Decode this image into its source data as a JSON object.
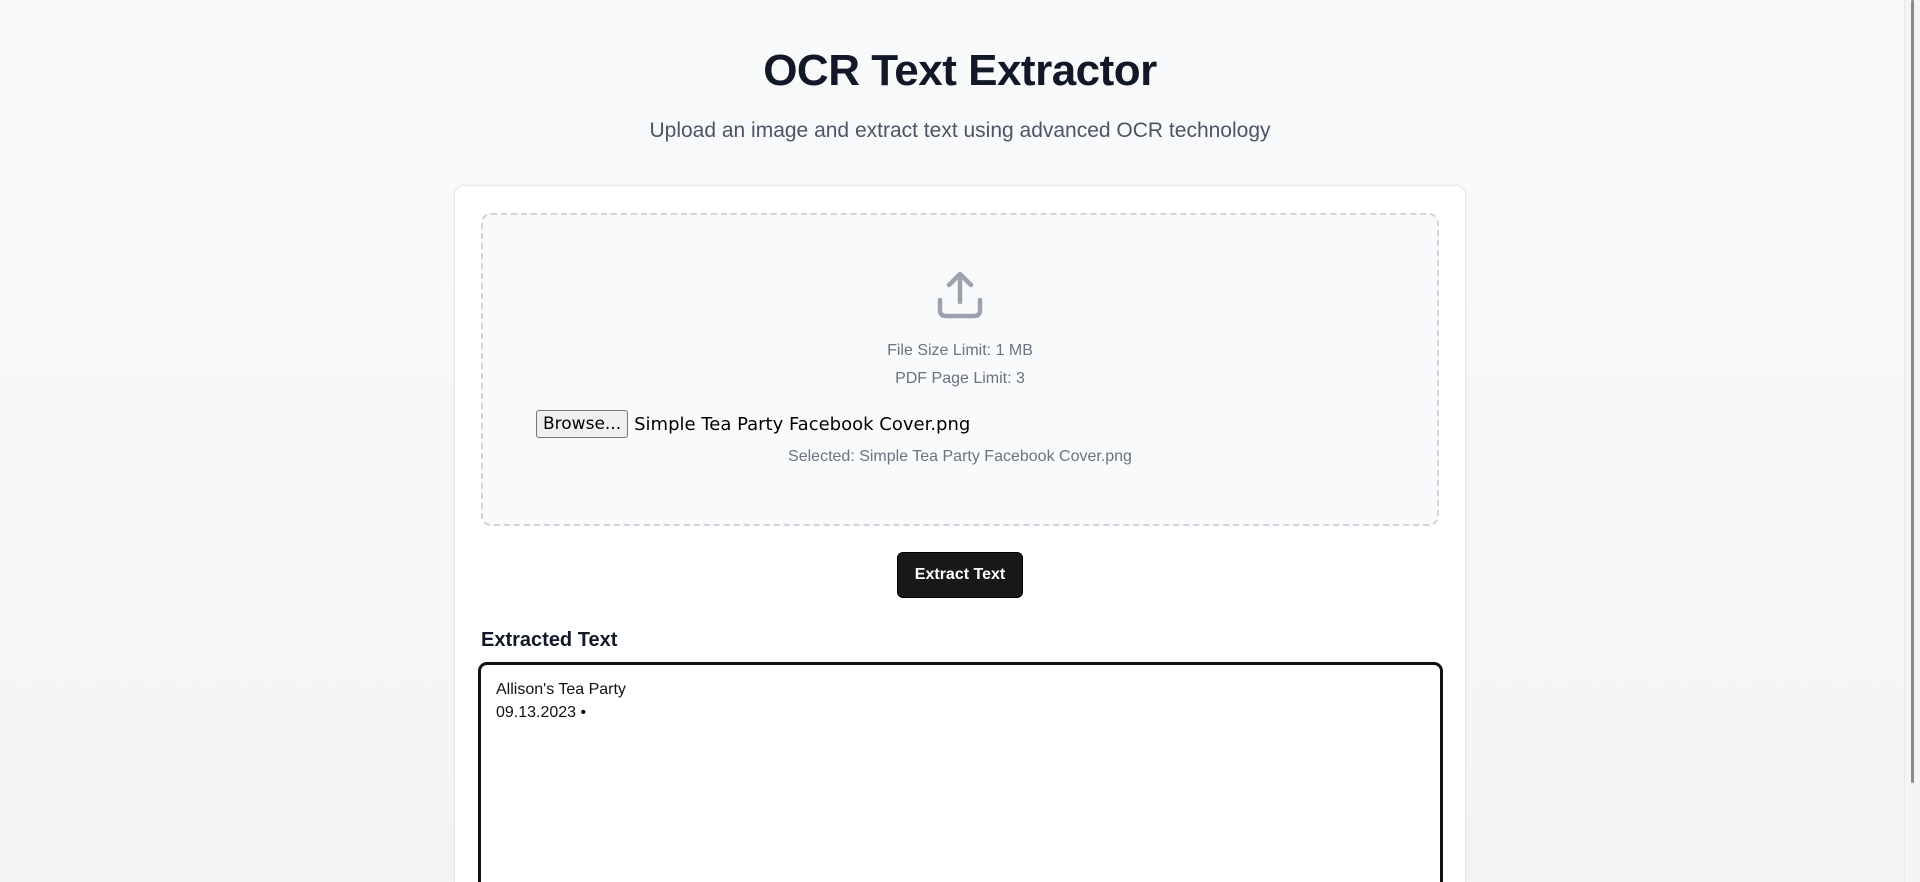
{
  "header": {
    "title": "OCR Text Extractor",
    "subtitle": "Upload an image and extract text using advanced OCR technology"
  },
  "upload": {
    "icon": "upload-icon",
    "file_size_limit": "File Size Limit: 1 MB",
    "pdf_page_limit": "PDF Page Limit: 3",
    "browse_label": "Browse...",
    "file_name": "Simple Tea Party Facebook Cover.png",
    "selected_text": "Selected: Simple Tea Party Facebook Cover.png"
  },
  "actions": {
    "extract_label": "Extract Text"
  },
  "result": {
    "label": "Extracted Text",
    "text": "Allison's Tea Party\n09.13.2023 •"
  },
  "colors": {
    "accent": "#18181b",
    "muted_text": "#6b7280",
    "border": "#d1d5db"
  }
}
